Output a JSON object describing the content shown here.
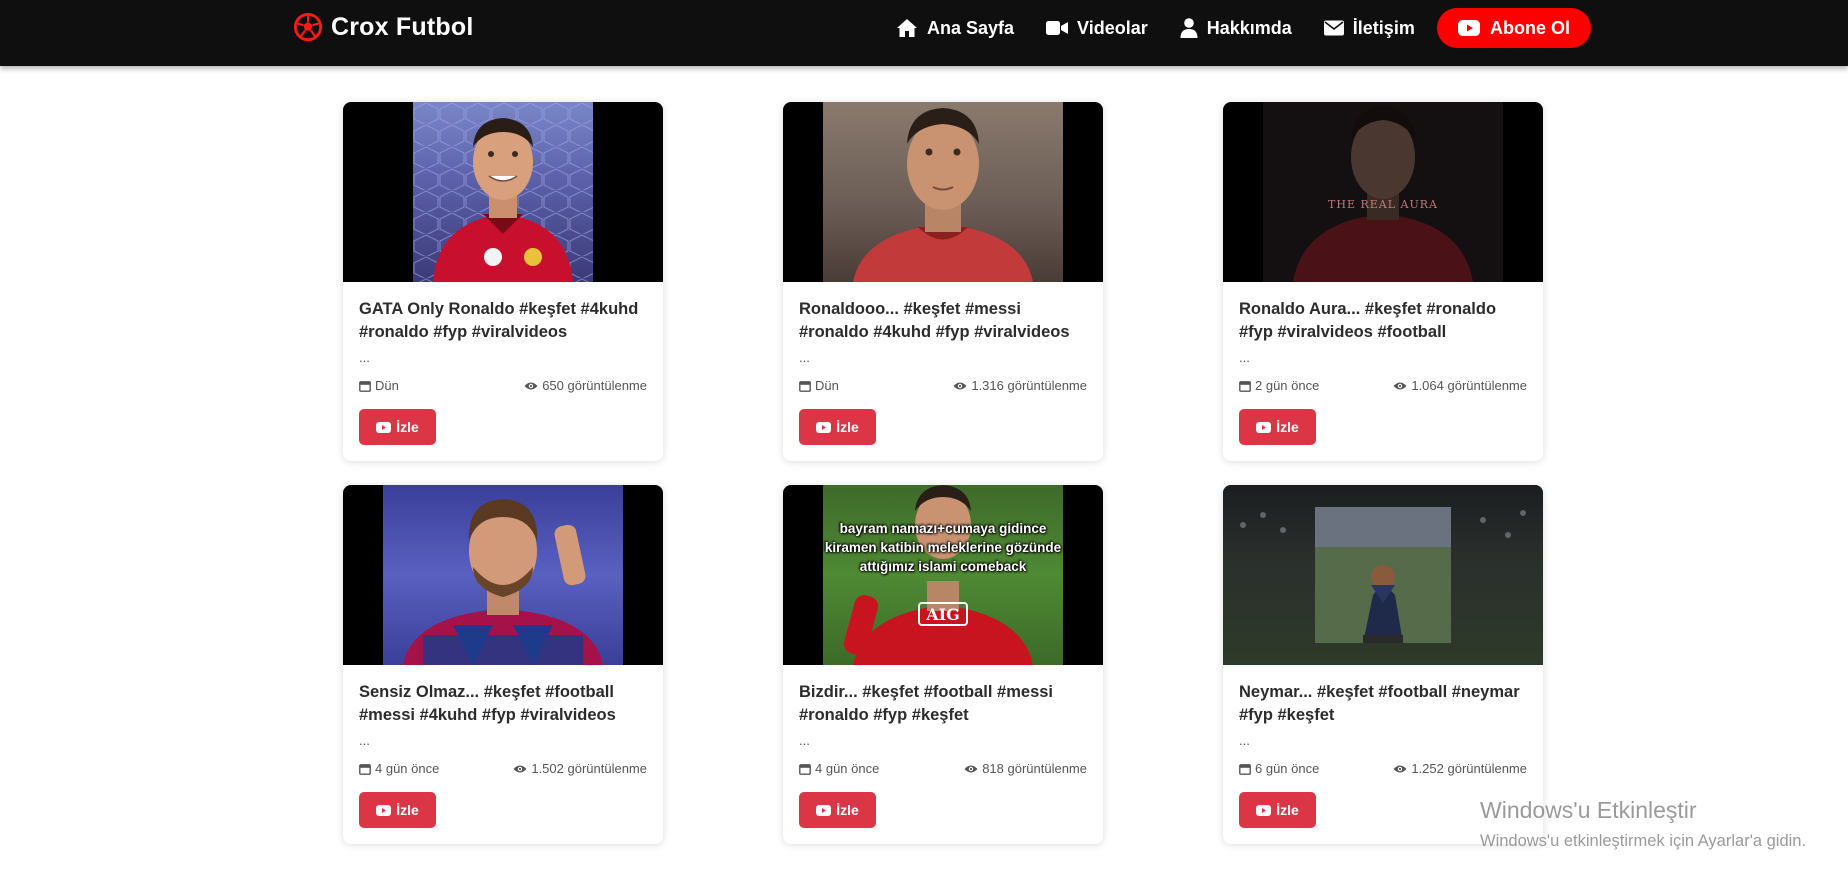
{
  "brand": {
    "name": "Crox Futbol",
    "icon": "soccer-ball-icon",
    "accent": "#ff1a1a"
  },
  "nav": {
    "items": [
      {
        "label": "Ana Sayfa",
        "icon": "home-icon"
      },
      {
        "label": "Videolar",
        "icon": "video-camera-icon"
      },
      {
        "label": "Hakkımda",
        "icon": "user-icon"
      },
      {
        "label": "İletişim",
        "icon": "envelope-icon"
      }
    ],
    "subscribe_label": "Abone Ol",
    "subscribe_icon": "youtube-icon",
    "subscribe_color": "#ff0000"
  },
  "videos": [
    {
      "title": "GATA Only Ronaldo #keşfet #4kuhd #ronaldo #fyp #viralvideos",
      "description": "...",
      "date": "Dün",
      "views": "650 görüntülenme",
      "watch_label": "İzle",
      "thumbnail": "ronaldo-portugal-smiling"
    },
    {
      "title": "Ronaldooo... #keşfet #messi #ronaldo #4kuhd #fyp #viralvideos",
      "description": "...",
      "date": "Dün",
      "views": "1.316 görüntülenme",
      "watch_label": "İzle",
      "thumbnail": "ronaldo-portugal-looking-up"
    },
    {
      "title": "Ronaldo Aura... #keşfet #ronaldo #fyp #viralvideos #football",
      "description": "...",
      "date": "2 gün önce",
      "views": "1.064 görüntülenme",
      "watch_label": "İzle",
      "thumbnail": "ronaldo-dark-aura",
      "thumbnail_text": "THE REAL AURA"
    },
    {
      "title": "Sensiz Olmaz... #keşfet #football #messi #4kuhd #fyp #viralvideos",
      "description": "...",
      "date": "4 gün önce",
      "views": "1.502 görüntülenme",
      "watch_label": "İzle",
      "thumbnail": "messi-barcelona"
    },
    {
      "title": "Bizdir... #keşfet #football #messi #ronaldo #fyp #keşfet",
      "description": "...",
      "date": "4 gün önce",
      "views": "818 görüntülenme",
      "watch_label": "İzle",
      "thumbnail": "ronaldo-manchester-united",
      "thumbnail_text": "bayram namazı+cumaya gidince kiramen katibin meleklerine gözünde attığımız islami comeback"
    },
    {
      "title": "Neymar... #keşfet #football #neymar #fyp #keşfet",
      "description": "...",
      "date": "6 gün önce",
      "views": "1.252 görüntülenme",
      "watch_label": "İzle",
      "thumbnail": "neymar-kneeling-stadium"
    }
  ],
  "windows_activation": {
    "title": "Windows'u Etkinleştir",
    "subtitle": "Windows'u etkinleştirmek için Ayarlar'a gidin."
  }
}
